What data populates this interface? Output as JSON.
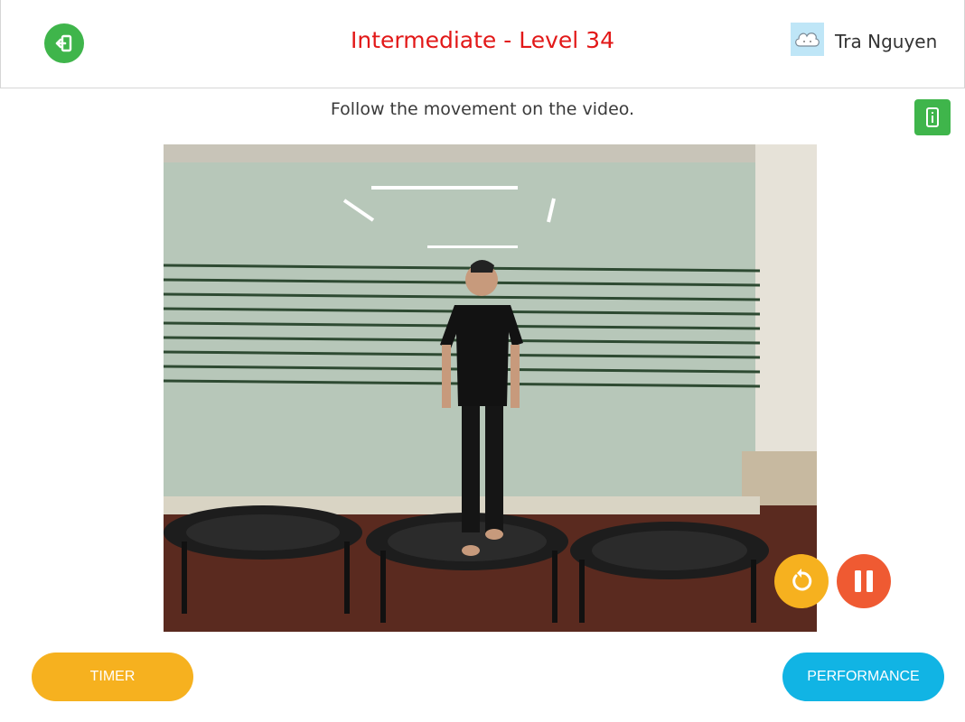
{
  "header": {
    "title": "Intermediate - Level 34",
    "exit_icon": "exit-door-icon",
    "user": {
      "name": "Tra Nguyen",
      "avatar_icon": "cloud-avatar-icon"
    }
  },
  "main": {
    "instruction": "Follow the movement on the video.",
    "info_icon": "phone-info-icon",
    "video": {
      "scene": "person-on-trampoline",
      "replay_icon": "replay-icon",
      "pause_icon": "pause-icon"
    }
  },
  "footer": {
    "timer_label": "TIMER",
    "performance_label": "PERFORMANCE"
  },
  "colors": {
    "green": "#3fb54b",
    "title_red": "#e21818",
    "orange": "#f6b11f",
    "red_orange": "#ef5a32",
    "cyan": "#11b4e4"
  }
}
